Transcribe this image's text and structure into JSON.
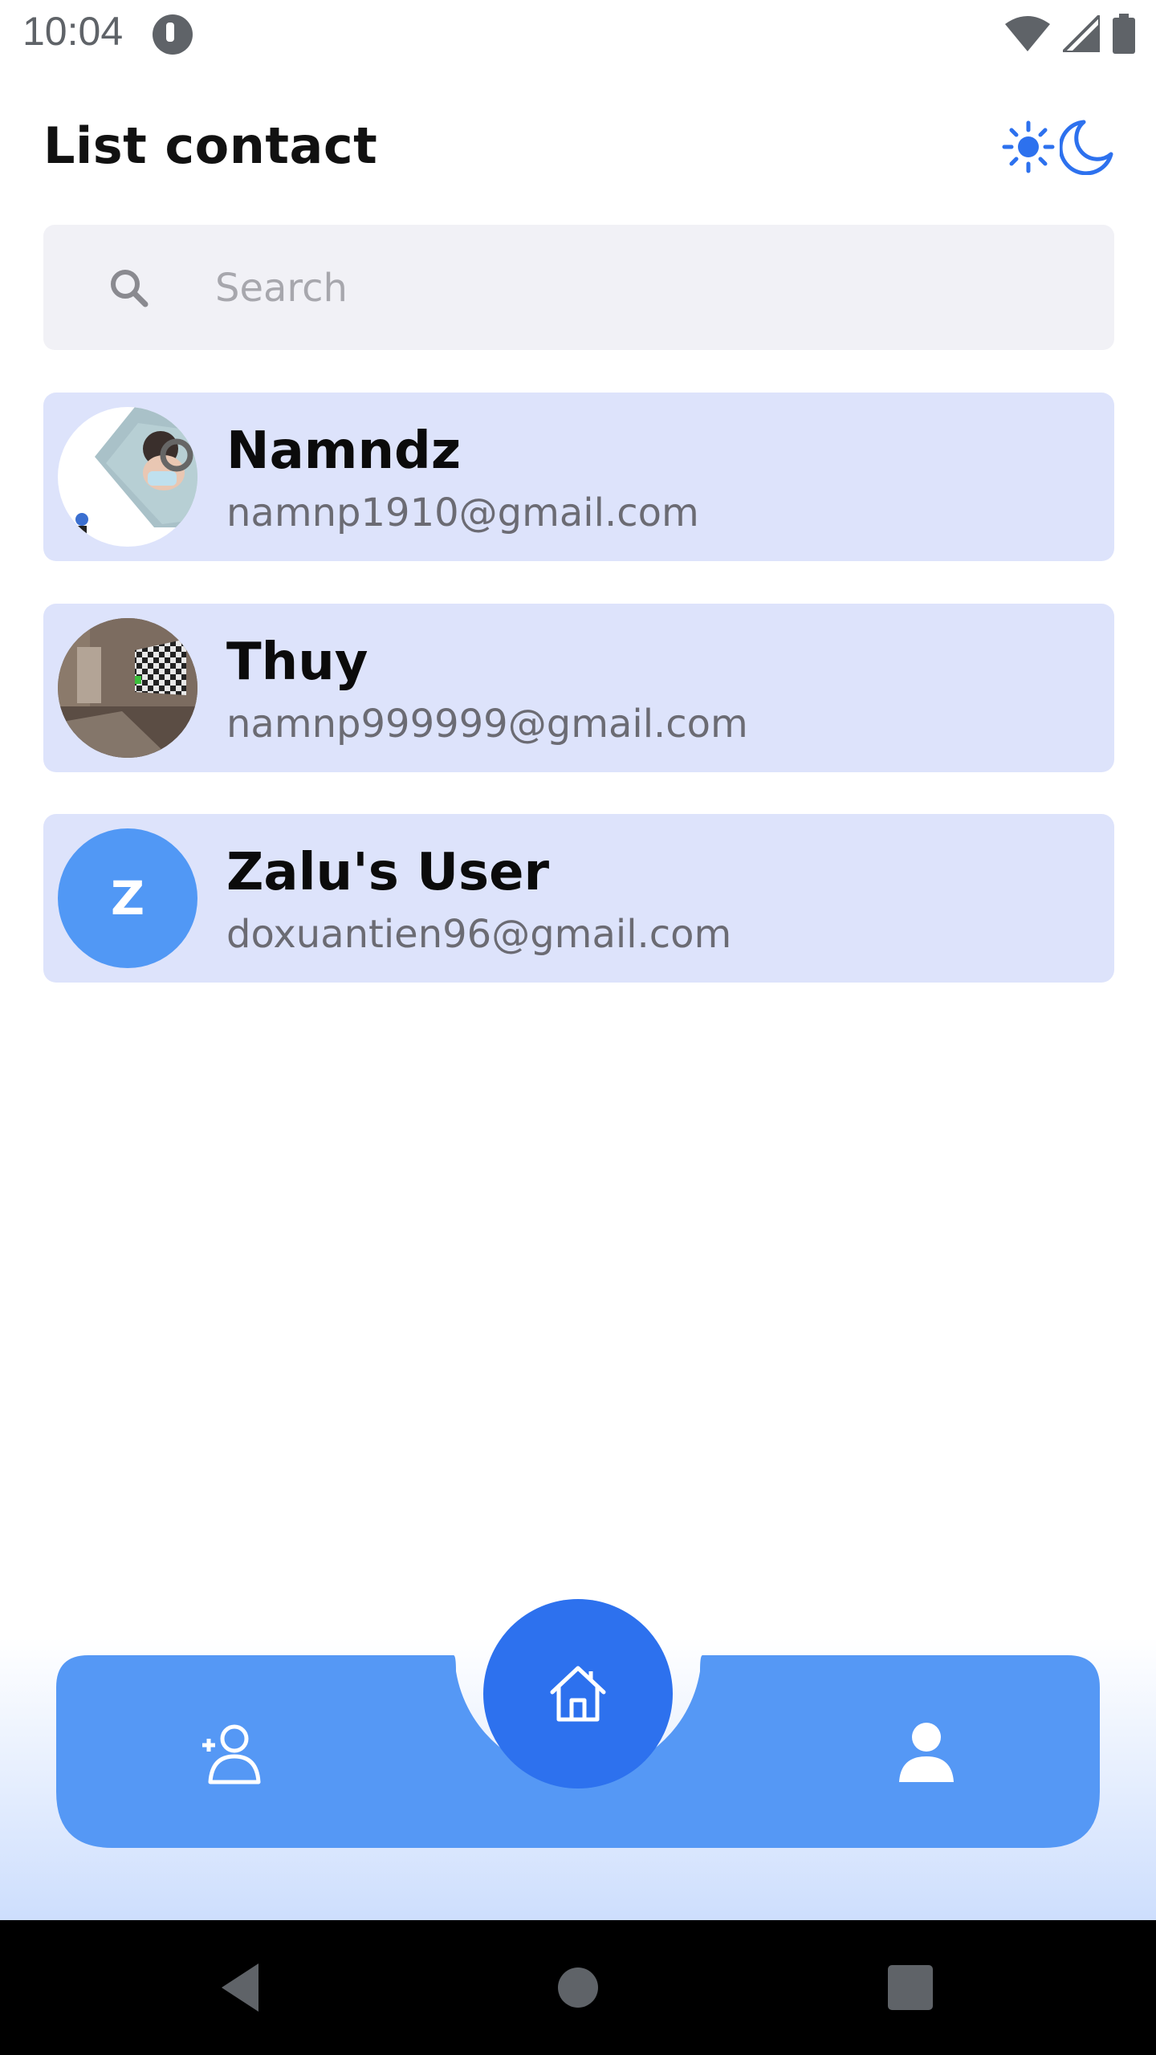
{
  "status_bar": {
    "time": "10:04"
  },
  "header": {
    "title": "List contact",
    "theme_icons": [
      "sun-icon",
      "moon-icon"
    ],
    "accent_color": "#2d71ee"
  },
  "search": {
    "placeholder": "Search",
    "value": ""
  },
  "contacts": [
    {
      "name": "Namndz",
      "email": "namnp1910@gmail.com",
      "avatar": "photo"
    },
    {
      "name": "Thuy",
      "email": "namnp999999@gmail.com",
      "avatar": "photo"
    },
    {
      "name": "Zalu's User",
      "email": "doxuantien96@gmail.com",
      "avatar": "letter",
      "avatar_letter": "Z"
    }
  ],
  "bottom_nav": {
    "left_icon": "add-user-icon",
    "center_icon": "home-icon",
    "right_icon": "profile-icon",
    "bar_color": "#5598f5",
    "fab_color": "#2d71ee"
  },
  "system_nav": {
    "icons": [
      "back-icon",
      "home-circle-icon",
      "recents-icon"
    ]
  }
}
